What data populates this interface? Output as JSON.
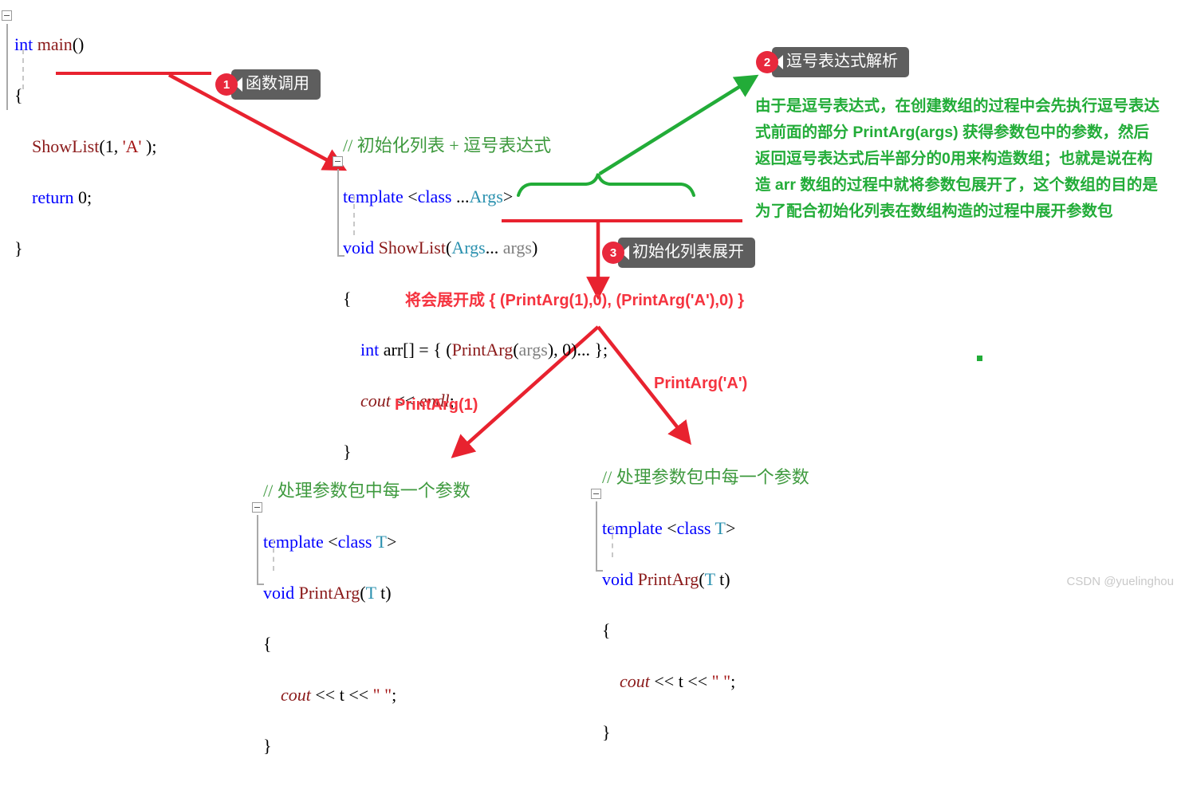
{
  "main_block": {
    "lines": [
      [
        {
          "t": "int",
          "c": "kw"
        },
        {
          "t": " ",
          "c": "plain"
        },
        {
          "t": "main",
          "c": "fn"
        },
        {
          "t": "()",
          "c": "pun"
        }
      ],
      [
        {
          "t": "{",
          "c": "pun"
        }
      ],
      [
        {
          "t": "    ",
          "c": "plain"
        },
        {
          "t": "ShowList",
          "c": "fn"
        },
        {
          "t": "(",
          "c": "pun"
        },
        {
          "t": "1",
          "c": "num"
        },
        {
          "t": ", ",
          "c": "pun"
        },
        {
          "t": "'A'",
          "c": "str"
        },
        {
          "t": " );",
          "c": "pun"
        }
      ],
      [
        {
          "t": "    ",
          "c": "plain"
        },
        {
          "t": "return",
          "c": "kw"
        },
        {
          "t": " ",
          "c": "plain"
        },
        {
          "t": "0",
          "c": "num"
        },
        {
          "t": ";",
          "c": "pun"
        }
      ],
      [
        {
          "t": "}",
          "c": "pun"
        }
      ]
    ]
  },
  "showlist_block": {
    "lines": [
      [
        {
          "t": "// 初始化列表 + 逗号表达式",
          "c": "cmt"
        }
      ],
      [
        {
          "t": "template",
          "c": "kw"
        },
        {
          "t": " ",
          "c": "plain"
        },
        {
          "t": "<",
          "c": "pun"
        },
        {
          "t": "class",
          "c": "kw"
        },
        {
          "t": " ...",
          "c": "pun"
        },
        {
          "t": "Args",
          "c": "cls"
        },
        {
          "t": ">",
          "c": "pun"
        }
      ],
      [
        {
          "t": "void",
          "c": "kw"
        },
        {
          "t": " ",
          "c": "plain"
        },
        {
          "t": "ShowList",
          "c": "fn"
        },
        {
          "t": "(",
          "c": "pun"
        },
        {
          "t": "Args",
          "c": "cls"
        },
        {
          "t": "... ",
          "c": "pun"
        },
        {
          "t": "args",
          "c": "var"
        },
        {
          "t": ")",
          "c": "pun"
        }
      ],
      [
        {
          "t": "{",
          "c": "pun"
        }
      ],
      [
        {
          "t": "    ",
          "c": "plain"
        },
        {
          "t": "int",
          "c": "kw"
        },
        {
          "t": " ",
          "c": "plain"
        },
        {
          "t": "arr",
          "c": "plain"
        },
        {
          "t": "[] = { (",
          "c": "pun"
        },
        {
          "t": "PrintArg",
          "c": "fn"
        },
        {
          "t": "(",
          "c": "pun"
        },
        {
          "t": "args",
          "c": "var"
        },
        {
          "t": "), ",
          "c": "pun"
        },
        {
          "t": "0",
          "c": "num"
        },
        {
          "t": ")... };",
          "c": "pun"
        }
      ],
      [
        {
          "t": "    ",
          "c": "plain"
        },
        {
          "t": "cout",
          "c": "ital"
        },
        {
          "t": " ",
          "c": "plain"
        },
        {
          "t": "<<",
          "c": "pun"
        },
        {
          "t": " ",
          "c": "plain"
        },
        {
          "t": "endl",
          "c": "ital"
        },
        {
          "t": ";",
          "c": "pun"
        }
      ],
      [
        {
          "t": "}",
          "c": "pun"
        }
      ]
    ]
  },
  "printarg_block_left": {
    "lines": [
      [
        {
          "t": "// 处理参数包中每一个参数",
          "c": "cmt"
        }
      ],
      [
        {
          "t": "template",
          "c": "kw"
        },
        {
          "t": " ",
          "c": "plain"
        },
        {
          "t": "<",
          "c": "pun"
        },
        {
          "t": "class",
          "c": "kw"
        },
        {
          "t": " ",
          "c": "plain"
        },
        {
          "t": "T",
          "c": "cls"
        },
        {
          "t": ">",
          "c": "pun"
        }
      ],
      [
        {
          "t": "void",
          "c": "kw"
        },
        {
          "t": " ",
          "c": "plain"
        },
        {
          "t": "PrintArg",
          "c": "fn"
        },
        {
          "t": "(",
          "c": "pun"
        },
        {
          "t": "T",
          "c": "cls"
        },
        {
          "t": " ",
          "c": "plain"
        },
        {
          "t": "t",
          "c": "plain"
        },
        {
          "t": ")",
          "c": "pun"
        }
      ],
      [
        {
          "t": "{",
          "c": "pun"
        }
      ],
      [
        {
          "t": "    ",
          "c": "plain"
        },
        {
          "t": "cout",
          "c": "ital"
        },
        {
          "t": " ",
          "c": "plain"
        },
        {
          "t": "<<",
          "c": "pun"
        },
        {
          "t": " t ",
          "c": "plain"
        },
        {
          "t": "<<",
          "c": "pun"
        },
        {
          "t": " ",
          "c": "plain"
        },
        {
          "t": "\" \"",
          "c": "str"
        },
        {
          "t": ";",
          "c": "pun"
        }
      ],
      [
        {
          "t": "}",
          "c": "pun"
        }
      ]
    ]
  },
  "printarg_block_right": {
    "lines": [
      [
        {
          "t": "// 处理参数包中每一个参数",
          "c": "cmt"
        }
      ],
      [
        {
          "t": "template",
          "c": "kw"
        },
        {
          "t": " ",
          "c": "plain"
        },
        {
          "t": "<",
          "c": "pun"
        },
        {
          "t": "class",
          "c": "kw"
        },
        {
          "t": " ",
          "c": "plain"
        },
        {
          "t": "T",
          "c": "cls"
        },
        {
          "t": ">",
          "c": "pun"
        }
      ],
      [
        {
          "t": "void",
          "c": "kw"
        },
        {
          "t": " ",
          "c": "plain"
        },
        {
          "t": "PrintArg",
          "c": "fn"
        },
        {
          "t": "(",
          "c": "pun"
        },
        {
          "t": "T",
          "c": "cls"
        },
        {
          "t": " ",
          "c": "plain"
        },
        {
          "t": "t",
          "c": "plain"
        },
        {
          "t": ")",
          "c": "pun"
        }
      ],
      [
        {
          "t": "{",
          "c": "pun"
        }
      ],
      [
        {
          "t": "    ",
          "c": "plain"
        },
        {
          "t": "cout",
          "c": "ital"
        },
        {
          "t": " ",
          "c": "plain"
        },
        {
          "t": "<<",
          "c": "pun"
        },
        {
          "t": " t ",
          "c": "plain"
        },
        {
          "t": "<<",
          "c": "pun"
        },
        {
          "t": " ",
          "c": "plain"
        },
        {
          "t": "\" \"",
          "c": "str"
        },
        {
          "t": ";",
          "c": "pun"
        }
      ],
      [
        {
          "t": "}",
          "c": "pun"
        }
      ]
    ]
  },
  "callouts": {
    "one": {
      "number": "1",
      "label": "函数调用"
    },
    "two": {
      "number": "2",
      "label": "逗号表达式解析"
    },
    "three": {
      "number": "3",
      "label": "初始化列表展开"
    }
  },
  "green_note": {
    "lines": [
      "由于是逗号表达式，在创建数组的过程中会先执行逗号表达",
      "式前面的部分 PrintArg(args) 获得参数包中的参数，然后",
      "返回逗号表达式后半部分的0用来构造数组；也就是说在构",
      "造 arr 数组的过程中就将参数包展开了，这个数组的目的是",
      "为了配合初始化列表在数组构造的过程中展开参数包"
    ]
  },
  "red_notes": {
    "expansion": "将会展开成 { (PrintArg(1),0), (PrintArg('A'),0) }",
    "arrow_left": "PrintArg(1)",
    "arrow_right": "PrintArg('A')"
  },
  "watermark": "CSDN @yuelinghou",
  "colors": {
    "keyword": "#0000ff",
    "function": "#8b1a1a",
    "class": "#2b91af",
    "comment": "#3f9a3f",
    "variable": "#808080",
    "string": "#a31515",
    "annotation_red": "#f5333f",
    "annotation_green": "#22ac38",
    "badge_red": "#e8283c",
    "bubble_gray": "#5e5e5e"
  }
}
